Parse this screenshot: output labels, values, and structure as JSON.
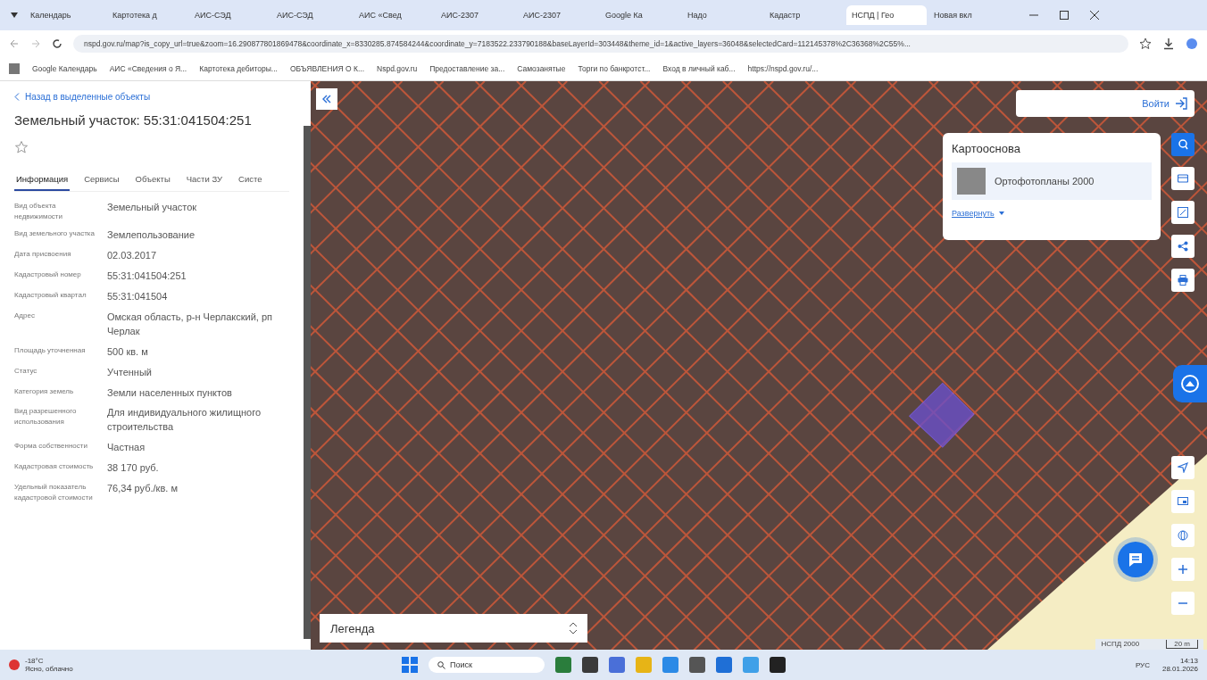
{
  "browser": {
    "tabs": [
      {
        "title": "Календарь",
        "selected": false
      },
      {
        "title": "Картотека д",
        "selected": false
      },
      {
        "title": "АИС-СЭД",
        "selected": false
      },
      {
        "title": "АИС-СЭД",
        "selected": false
      },
      {
        "title": "АИС «Свед",
        "selected": false
      },
      {
        "title": "АИС-2307",
        "selected": false
      },
      {
        "title": "АИС-2307",
        "selected": false
      },
      {
        "title": "Google Ка",
        "selected": false
      },
      {
        "title": "Надо",
        "selected": false
      },
      {
        "title": "Кадастр",
        "selected": false
      },
      {
        "title": "НСПД | Гео",
        "selected": true
      },
      {
        "title": "Новая вкл",
        "selected": false
      }
    ],
    "url": "nspd.gov.ru/map?is_copy_url=true&zoom=16.290877801869478&coordinate_x=8330285.874584244&coordinate_y=7183522.233790188&baseLayerId=303448&theme_id=1&active_layers=36048&selectedCard=112145378%2C36368%2C55%...",
    "bookmarks": [
      "Google Календарь",
      "АИС «Сведения о Я...",
      "Картотека дебиторы...",
      "ОБЪЯВЛЕНИЯ О К...",
      "Nspd.gov.ru",
      "Предоставление за...",
      "Самозанятые",
      "Торги по банкротст...",
      "Вход в личный каб...",
      "https://nspd.gov.ru/..."
    ]
  },
  "panel": {
    "back_link": "Назад в выделенные объекты",
    "title": "Земельный участок: 55:31:041504:251",
    "tabs": [
      {
        "label": "Информация",
        "selected": true
      },
      {
        "label": "Сервисы",
        "selected": false
      },
      {
        "label": "Объекты",
        "selected": false
      },
      {
        "label": "Части ЗУ",
        "selected": false
      },
      {
        "label": "Систе",
        "selected": false
      }
    ],
    "fields": [
      {
        "label": "Вид объекта недвижимости",
        "value": "Земельный участок"
      },
      {
        "label": "Вид земельного участка",
        "value": "Землепользование"
      },
      {
        "label": "Дата присвоения",
        "value": "02.03.2017"
      },
      {
        "label": "Кадастровый номер",
        "value": "55:31:041504:251"
      },
      {
        "label": "Кадастровый квартал",
        "value": "55:31:041504"
      },
      {
        "label": "Адрес",
        "value": "Омская область, р-н Черлакский, рп Черлак"
      },
      {
        "label": "Площадь уточненная",
        "value": "500 кв. м"
      },
      {
        "label": "Статус",
        "value": "Учтенный"
      },
      {
        "label": "Категория земель",
        "value": "Земли населенных пунктов"
      },
      {
        "label": "Вид разрешенного использования",
        "value": "Для индивидуального жилищного строительства"
      },
      {
        "label": "Форма собственности",
        "value": "Частная"
      },
      {
        "label": "Кадастровая стоимость",
        "value": "38 170 руб."
      },
      {
        "label": "Удельный показатель кадастровой стоимости",
        "value": "76,34 руб./кв. м"
      }
    ]
  },
  "map": {
    "login": "Войти",
    "basemap": {
      "title": "Картооснова",
      "layer": "Ортофотопланы 2000",
      "expand": "Развернуть"
    },
    "legend": "Легенда",
    "attribution": "НСПД 2000",
    "scale": "20 m"
  },
  "taskbar": {
    "weather_temp": "-18°C",
    "weather_text": "Ясно, облачно",
    "search": "Поиск",
    "lang": "РУС",
    "time": "14:13",
    "date": "28.01.2026"
  }
}
